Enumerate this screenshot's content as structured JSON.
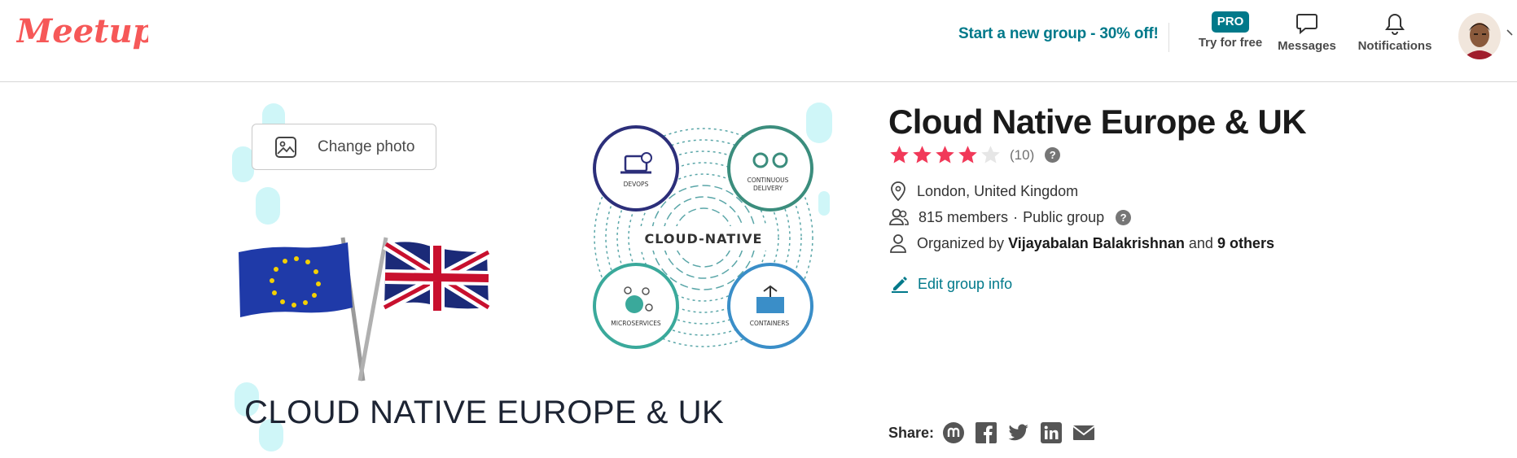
{
  "header": {
    "logo_text": "Meetup",
    "promo_link": "Start a new group - 30% off!",
    "pro": {
      "badge": "PRO",
      "label": "Try for free"
    },
    "messages_label": "Messages",
    "notifications_label": "Notifications"
  },
  "banner": {
    "change_photo_label": "Change photo",
    "title": "CLOUD NATIVE EUROPE & UK",
    "diagram": {
      "center": "CLOUD-NATIVE",
      "devops": "DEVOPS",
      "delivery_line1": "CONTINUOUS",
      "delivery_line2": "DELIVERY",
      "microservices": "MICROSERVICES",
      "containers": "CONTAINERS"
    }
  },
  "group": {
    "name": "Cloud Native Europe & UK",
    "rating": {
      "stars": 4,
      "max": 5,
      "count": "(10)"
    },
    "help_mark": "?",
    "location": "London, United Kingdom",
    "members": "815 members",
    "separator": "·",
    "privacy": "Public group",
    "organized_by_prefix": "Organized by",
    "organizer": "Vijayabalan Balakrishnan",
    "and_text": "and",
    "others": "9 others",
    "edit_label": "Edit group info"
  },
  "share": {
    "label": "Share:",
    "icons": [
      "meetup-icon",
      "facebook-icon",
      "twitter-icon",
      "linkedin-icon",
      "email-icon"
    ]
  },
  "colors": {
    "brand": "#f65858",
    "teal": "#00798a",
    "star": "#f13959",
    "star_empty": "#e6e6e6"
  }
}
